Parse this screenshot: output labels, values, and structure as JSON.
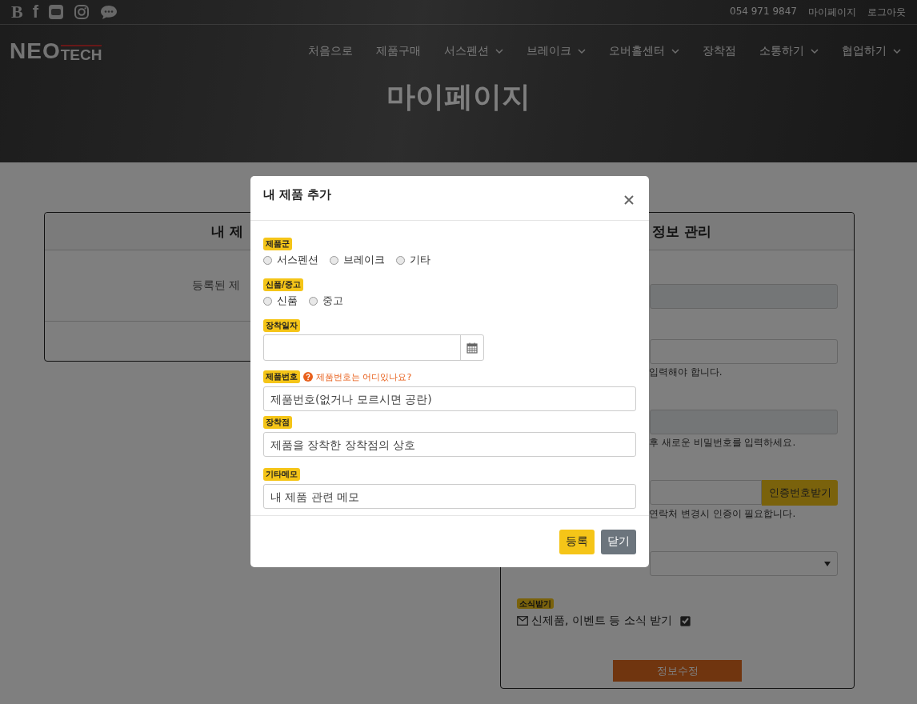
{
  "header": {
    "social_links": [
      {
        "kind": "glyph",
        "label": "B"
      },
      {
        "kind": "glyph",
        "label": "f"
      },
      {
        "kind": "video"
      },
      {
        "kind": "camera"
      },
      {
        "kind": "chat"
      }
    ],
    "contact_links": [
      "054 971 9847",
      "마이페이지",
      "로그아웃"
    ],
    "logo": {
      "main": "NEO",
      "sub": "TECH"
    },
    "nav": [
      {
        "label": "처음으로",
        "dropdown": false
      },
      {
        "label": "제품구매",
        "dropdown": false
      },
      {
        "label": "서스펜션",
        "dropdown": true
      },
      {
        "label": "브레이크",
        "dropdown": true
      },
      {
        "label": "오버홀센터",
        "dropdown": true
      },
      {
        "label": "장착점",
        "dropdown": false
      },
      {
        "label": "소통하기",
        "dropdown": true
      },
      {
        "label": "협업하기",
        "dropdown": true
      }
    ],
    "page_title": "마이페이지"
  },
  "my_products_card": {
    "title": "내 제",
    "empty_text": "등록된 제"
  },
  "my_info_card": {
    "title": "정보 관리",
    "fields": [
      {
        "kind": "readonly"
      },
      {
        "kind": "input",
        "hint": "입력해야 합니다."
      },
      {
        "kind": "readonly",
        "hint": "후 새로운 비밀번호를 입력하세요."
      },
      {
        "kind": "verify",
        "button": "인증번호받기",
        "hint": "연락처 변경시 인증이 필요합니다."
      },
      {
        "kind": "select"
      }
    ],
    "newsletter": {
      "badge": "소식받기",
      "label": "신제품, 이벤트 등 소식 받기",
      "checked": true
    },
    "submit": "정보수정"
  },
  "modal": {
    "title": "내 제품 추가",
    "groups": [
      {
        "kind": "radio",
        "label": "제품군",
        "options": [
          {
            "label": "서스펜션",
            "selected": false
          },
          {
            "label": "브레이크",
            "selected": false
          },
          {
            "label": "기타",
            "selected": false
          }
        ]
      },
      {
        "kind": "radio",
        "label": "신품/중고",
        "options": [
          {
            "label": "신품",
            "selected": false
          },
          {
            "label": "중고",
            "selected": false
          }
        ]
      },
      {
        "kind": "date",
        "label": "장착일자"
      },
      {
        "kind": "text",
        "label": "제품번호",
        "help": "제품번호는 어디있나요?",
        "placeholder": "제품번호(없거나 모르시면 공란)"
      },
      {
        "kind": "text",
        "label": "장착점",
        "placeholder": "제품을 장착한 장착점의 상호"
      },
      {
        "kind": "text",
        "label": "기타메모",
        "placeholder": "내 제품 관련 메모"
      }
    ],
    "buttons": [
      {
        "label": "등록",
        "kind": "primary"
      },
      {
        "label": "닫기",
        "kind": "secondary"
      }
    ]
  }
}
